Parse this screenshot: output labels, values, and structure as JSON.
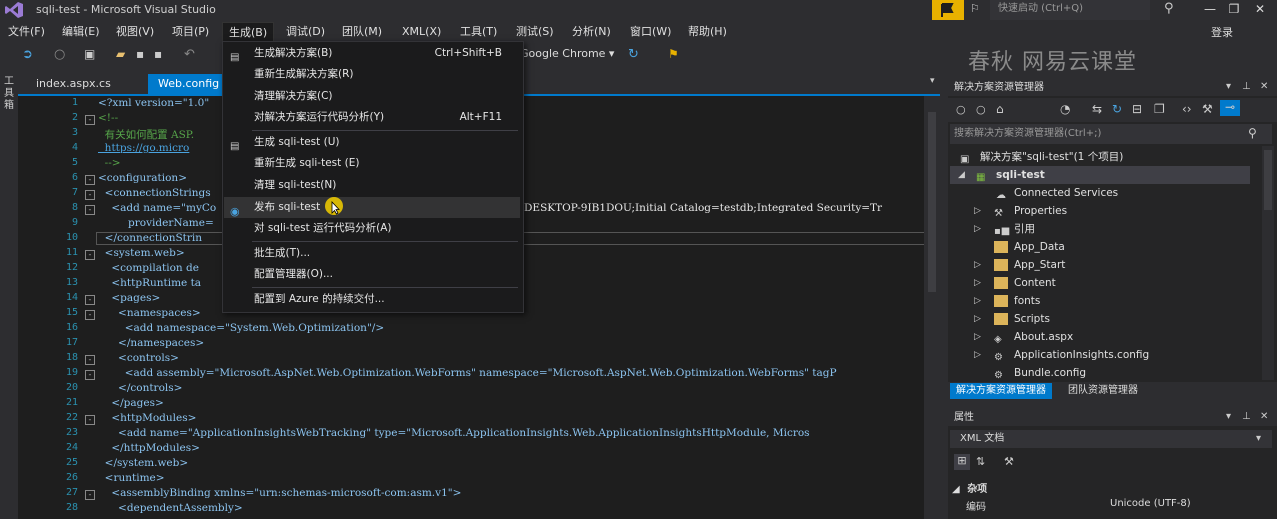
{
  "window": {
    "title": "sqli-test - Microsoft Visual Studio",
    "quick_launch_placeholder": "快速启动 (Ctrl+Q)",
    "login": "登录"
  },
  "menus": [
    "文件(F)",
    "编辑(E)",
    "视图(V)",
    "项目(P)",
    "生成(B)",
    "调试(D)",
    "团队(M)",
    "XML(X)",
    "工具(T)",
    "测试(S)",
    "分析(N)",
    "窗口(W)",
    "帮助(H)"
  ],
  "toolbar": {
    "run_target": "Google Chrome"
  },
  "watermark": {
    "text": "春秋  网易云课堂"
  },
  "toolbox": {
    "label": "工具箱"
  },
  "tabs": [
    {
      "label": "index.aspx.cs"
    },
    {
      "label": "Web.config"
    }
  ],
  "editor": {
    "line_numbers": [
      "1",
      "2",
      "3",
      "4",
      "5",
      "6",
      "7",
      "8",
      "9",
      "10",
      "11",
      "12",
      "13",
      "14",
      "15",
      "16",
      "17",
      "18",
      "19",
      "20",
      "21",
      "22",
      "23",
      "24",
      "25",
      "26",
      "27",
      "28"
    ],
    "lines": [
      "<?xml version=\"1.0\"",
      "<!--",
      "  有关如何配置 ASP.",
      "  https://go.micro",
      "  -->",
      "<configuration>",
      "  <connectionStrings",
      "    <add name=\"myCo",
      "         providerName=",
      "  </connectionStrin",
      "  <system.web>",
      "    <compilation de",
      "    <httpRuntime ta",
      "    <pages>",
      "      <namespaces>",
      "        <add namespace=\"System.Web.Optimization\"/>",
      "      </namespaces>",
      "      <controls>",
      "        <add assembly=\"Microsoft.AspNet.Web.Optimization.WebForms\" namespace=\"Microsoft.AspNet.Web.Optimization.WebForms\" tagP",
      "      </controls>",
      "    </pages>",
      "    <httpModules>",
      "      <add name=\"ApplicationInsightsWebTracking\" type=\"Microsoft.ApplicationInsights.Web.ApplicationInsightsHttpModule, Micros",
      "    </httpModules>",
      "  </system.web>",
      "  <runtime>",
      "    <assemblyBinding xmlns=\"urn:schemas-microsoft-com:asm.v1\">",
      "      <dependentAssembly>"
    ],
    "line8_tail": "DESKTOP-9IB1DOU;Initial Catalog=testdb;Integrated Security=Tr"
  },
  "build_menu": {
    "items": [
      {
        "label": "生成解决方案(B)",
        "shortcut": "Ctrl+Shift+B"
      },
      {
        "label": "重新生成解决方案(R)",
        "shortcut": ""
      },
      {
        "label": "清理解决方案(C)",
        "shortcut": ""
      },
      {
        "label": "对解决方案运行代码分析(Y)",
        "shortcut": "Alt+F11"
      },
      {
        "label": "生成 sqli-test (U)",
        "shortcut": ""
      },
      {
        "label": "重新生成 sqli-test (E)",
        "shortcut": ""
      },
      {
        "label": "清理 sqli-test(N)",
        "shortcut": ""
      },
      {
        "label": "发布 sqli-test",
        "shortcut": ""
      },
      {
        "label": "对 sqli-test 运行代码分析(A)",
        "shortcut": ""
      },
      {
        "label": "批生成(T)...",
        "shortcut": ""
      },
      {
        "label": "配置管理器(O)...",
        "shortcut": ""
      },
      {
        "label": "配置到 Azure 的持续交付...",
        "shortcut": ""
      }
    ]
  },
  "solution_explorer": {
    "title": "解决方案资源管理器",
    "search_placeholder": "搜索解决方案资源管理器(Ctrl+;)",
    "tree": [
      {
        "label": "解决方案\"sqli-test\"(1 个项目)",
        "icon": "solution-icon"
      },
      {
        "label": "sqli-test",
        "icon": "project-icon"
      },
      {
        "label": "Connected Services",
        "icon": "connected-services-icon"
      },
      {
        "label": "Properties",
        "icon": "wrench-icon"
      },
      {
        "label": "引用",
        "icon": "references-icon"
      },
      {
        "label": "App_Data",
        "icon": "folder-icon"
      },
      {
        "label": "App_Start",
        "icon": "folder-icon"
      },
      {
        "label": "Content",
        "icon": "folder-icon"
      },
      {
        "label": "fonts",
        "icon": "folder-icon"
      },
      {
        "label": "Scripts",
        "icon": "folder-icon"
      },
      {
        "label": "About.aspx",
        "icon": "aspx-file-icon"
      },
      {
        "label": "ApplicationInsights.config",
        "icon": "config-file-icon"
      },
      {
        "label": "Bundle.config",
        "icon": "config-file-icon"
      }
    ],
    "bottom_tabs": [
      "解决方案资源管理器",
      "团队资源管理器"
    ]
  },
  "properties": {
    "title": "属性",
    "object": "XML 文档",
    "category": "杂项",
    "rows": [
      {
        "name": "编码",
        "value": "Unicode (UTF-8)"
      }
    ]
  },
  "colors": {
    "accent": "#007acc",
    "background": "#2d2d30",
    "editor_bg": "#1e1e1e",
    "highlight": "#e8b100"
  }
}
